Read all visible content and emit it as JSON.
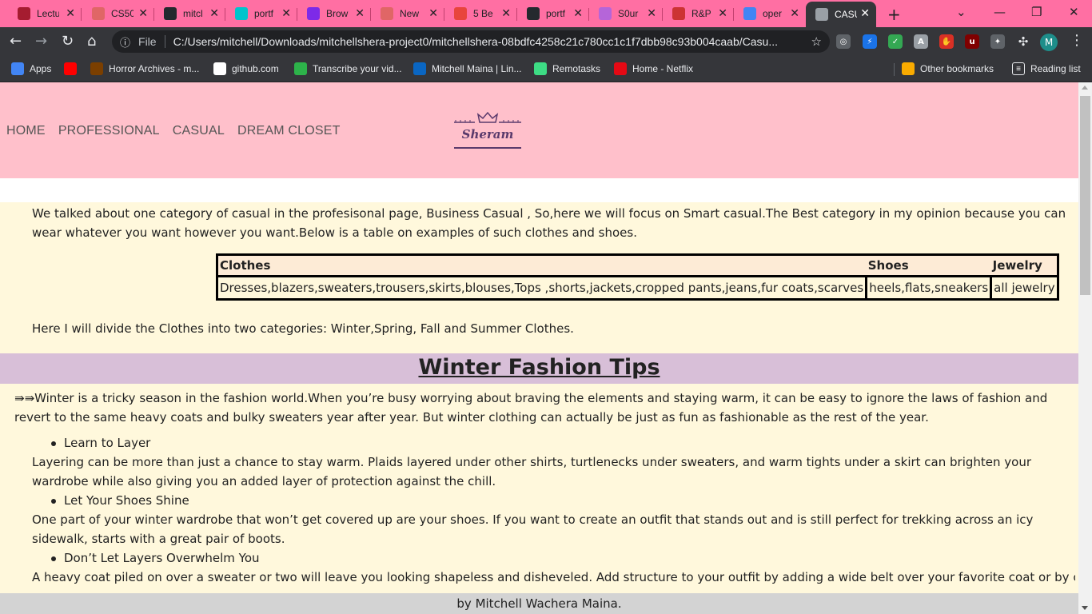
{
  "browser": {
    "tabs": [
      {
        "title": "Lectu",
        "icon": "harvard-icon",
        "color": "#a51c30"
      },
      {
        "title": "CS50",
        "icon": "globe-icon",
        "color": "#e06666"
      },
      {
        "title": "mitcl",
        "icon": "github-icon",
        "color": "#24292e"
      },
      {
        "title": "portf",
        "icon": "canva-icon",
        "color": "#00c4cc"
      },
      {
        "title": "Brow",
        "icon": "canva-icon",
        "color": "#7d2ae8"
      },
      {
        "title": "New",
        "icon": "globe-icon",
        "color": "#e06666"
      },
      {
        "title": "5 Be",
        "icon": "s-icon",
        "color": "#e8453c"
      },
      {
        "title": "portf",
        "icon": "github-icon",
        "color": "#24292e"
      },
      {
        "title": "S0ur",
        "icon": "swirl-icon",
        "color": "#b565d9"
      },
      {
        "title": "R&P",
        "icon": "rp-icon",
        "color": "#cc3333"
      },
      {
        "title": "oper",
        "icon": "google-icon",
        "color": "#4285f4"
      },
      {
        "title": "CASU",
        "icon": "globe-icon",
        "color": "#9aa0a6"
      }
    ],
    "tab_close": "✕",
    "new_tab": "+",
    "window_controls": {
      "minimize": "—",
      "restore": "❐",
      "close": "✕"
    },
    "omnibox": {
      "info_icon": "ⓘ",
      "scheme_label": "File",
      "url": "C:/Users/mitchell/Downloads/mitchellshera-project0/mitchellshera-08bdfc4258c21c780cc1c1f7dbb98c93b004caab/Casu..."
    },
    "profile_initial": "M",
    "bookmarks": [
      {
        "label": "Apps",
        "icon": "apps-grid-icon",
        "color": "#4285f4"
      },
      {
        "label": "",
        "icon": "youtube-icon",
        "color": "#ff0000"
      },
      {
        "label": "Horror Archives - m...",
        "icon": "horror-icon",
        "color": "#7b3f00"
      },
      {
        "label": "github.com",
        "icon": "github-icon",
        "color": "#ffffff"
      },
      {
        "label": "Transcribe your vid...",
        "icon": "transcribe-icon",
        "color": "#2db34a"
      },
      {
        "label": "Mitchell Maina | Lin...",
        "icon": "linkedin-icon",
        "color": "#0a66c2"
      },
      {
        "label": "Remotasks",
        "icon": "remotasks-icon",
        "color": "#3ddc84"
      },
      {
        "label": "Home - Netflix",
        "icon": "netflix-icon",
        "color": "#e50914"
      }
    ],
    "other_bookmarks": "Other bookmarks",
    "reading_list": "Reading list"
  },
  "site": {
    "nav": [
      "HOME",
      "PROFESSIONAL",
      "CASUAL",
      "DREAM CLOSET"
    ],
    "logo_text": "Sheram",
    "intro_text": "We talked about one category of casual in the profesisonal page, Business Casual , So,here we will focus on Smart casual.The Best category in my opinion because you can wear whatever you want however you want.Below is a table on examples of such clothes and shoes.",
    "table": {
      "headers": [
        "Clothes",
        "Shoes",
        "Jewelry"
      ],
      "row": [
        "Dresses,blazers,sweaters,trousers,skirts,blouses,Tops ,shorts,jackets,cropped pants,jeans,fur coats,scarves",
        "heels,flats,sneakers",
        "all jewelry"
      ]
    },
    "divide_text": "Here I will divide the Clothes into two categories: Winter,Spring, Fall and Summer Clothes.",
    "winter": {
      "title": "Winter Fashion Tips",
      "intro": "⇛⇛Winter is a tricky season in the fashion world.When you’re busy worrying about braving the elements and staying warm, it can be easy to ignore the laws of fashion and revert to the same heavy coats and bulky sweaters year after year. But winter clothing can actually be just as fun as fashionable as the rest of the year.",
      "tips": [
        {
          "title": "Learn to Layer",
          "text": "Layering can be more than just a chance to stay warm. Plaids layered under other shirts, turtlenecks under sweaters, and warm tights under a skirt can brighten your wardrobe while also giving you an added layer of protection against the chill."
        },
        {
          "title": "Let Your Shoes Shine",
          "text": "One part of your winter wardrobe that won’t get covered up are your shoes. If you want to create an outfit that stands out and is still perfect for trekking across an icy sidewalk, starts with a great pair of boots."
        },
        {
          "title": "Don’t Let Layers Overwhelm You",
          "text": "A heavy coat piled on over a sweater or two will leave you looking shapeless and disheveled. Add structure to your outfit by adding a wide belt over your favorite coat or by choosing"
        }
      ]
    },
    "footer": "by Mitchell Wachera Maina."
  }
}
